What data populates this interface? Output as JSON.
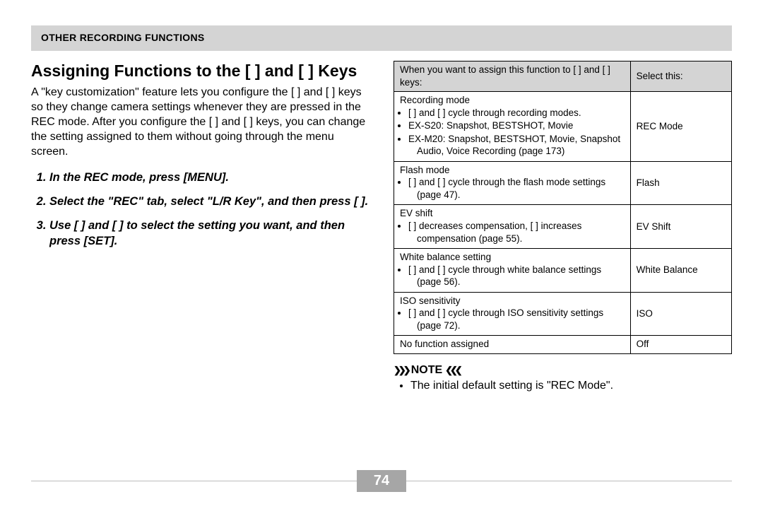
{
  "header": "OTHER RECORDING FUNCTIONS",
  "title": "Assigning Functions to the [   ] and [   ] Keys",
  "intro": "A \"key customization\" feature lets you configure the [   ] and [   ] keys so they change camera settings whenever they are pressed in the REC mode. After you configure the [   ] and [   ] keys, you can change the setting assigned to them without going through the menu screen.",
  "steps": [
    "In the REC mode, press [MENU].",
    "Select the \"REC\" tab, select \"L/R Key\", and then press [   ].",
    "Use [   ] and [   ] to select the setting you want, and then press [SET]."
  ],
  "table": {
    "col_widths": [
      "70%",
      "30%"
    ],
    "header_left": "When you want to assign this function to [   ] and [   ] keys:",
    "header_right": "Select this:",
    "rows": [
      {
        "title": "Recording mode",
        "bullets": [
          "[   ] and [   ] cycle through recording modes.",
          "EX-S20: Snapshot, BESTSHOT, Movie",
          "EX-M20: Snapshot, BESTSHOT, Movie, Snapshot Audio, Voice Recording (page 173)"
        ],
        "select": "REC Mode"
      },
      {
        "title": "Flash mode",
        "bullets": [
          "[   ] and [   ] cycle through the flash mode settings (page 47)."
        ],
        "select": "Flash"
      },
      {
        "title": "EV shift",
        "bullets": [
          "[   ] decreases compensation, [   ] increases compensation (page 55)."
        ],
        "select": "EV Shift"
      },
      {
        "title": "White balance setting",
        "bullets": [
          "[   ] and [   ] cycle through white balance settings (page 56)."
        ],
        "select": "White Balance"
      },
      {
        "title": "ISO sensitivity",
        "bullets": [
          "[   ] and [   ] cycle through ISO sensitivity settings (page 72)."
        ],
        "select": "ISO"
      },
      {
        "title": "No function assigned",
        "bullets": [],
        "select": "Off"
      }
    ]
  },
  "note_label": "NOTE",
  "note_items": [
    "The initial default setting is \"REC Mode\"."
  ],
  "page_number": "74"
}
